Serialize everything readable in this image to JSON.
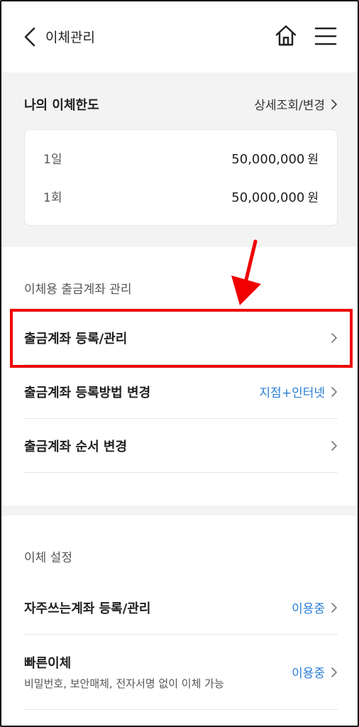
{
  "header": {
    "title": "이체관리"
  },
  "limit": {
    "title": "나의 이체한도",
    "link_label": "상세조회/변경",
    "rows": [
      {
        "label": "1일",
        "amount": "50,000,000",
        "unit": "원"
      },
      {
        "label": "1회",
        "amount": "50,000,000",
        "unit": "원"
      }
    ]
  },
  "withdrawal": {
    "section_title": "이체용 출금계좌 관리",
    "items": [
      {
        "label": "출금계좌 등록/관리",
        "value": ""
      },
      {
        "label": "출금계좌 등록방법 변경",
        "value": "지점+인터넷"
      },
      {
        "label": "출금계좌 순서 변경",
        "value": ""
      }
    ]
  },
  "transfer_settings": {
    "section_title": "이체 설정",
    "items": [
      {
        "label": "자주쓰는계좌 등록/관리",
        "value": "이용중"
      },
      {
        "label": "빠른이체",
        "sublabel": "비밀번호, 보안매체, 전자서명 없이 이체 가능",
        "value": "이용중"
      }
    ]
  },
  "colors": {
    "accent_blue": "#2a7fd4",
    "highlight_red": "#f00000",
    "section_gray": "#f3f3f3"
  }
}
